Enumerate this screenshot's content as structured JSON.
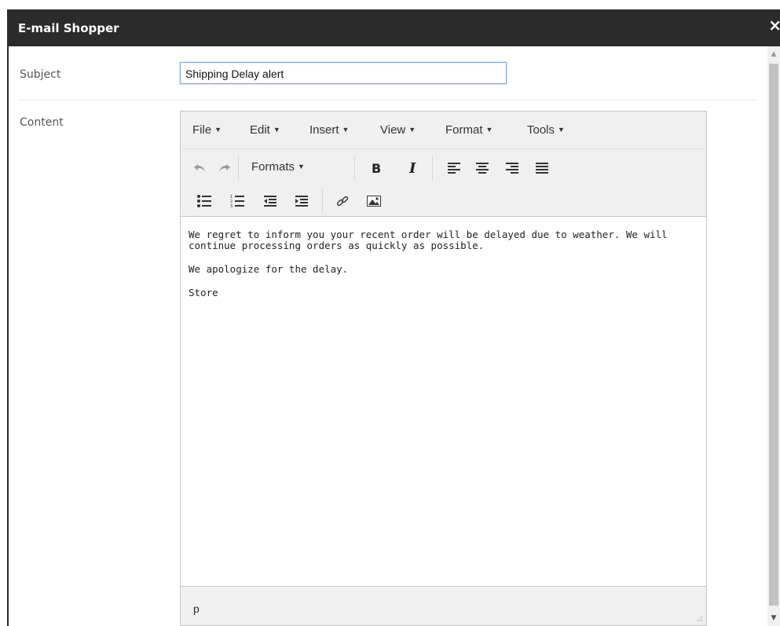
{
  "dialog": {
    "title": "E-mail Shopper",
    "close_glyph": "×"
  },
  "form": {
    "subject_label": "Subject",
    "subject_value": "Shipping Delay alert",
    "content_label": "Content"
  },
  "editor": {
    "menus": [
      {
        "label": "File"
      },
      {
        "label": "Edit"
      },
      {
        "label": "Insert"
      },
      {
        "label": "View"
      },
      {
        "label": "Format"
      },
      {
        "label": "Tools"
      }
    ],
    "toolbar": {
      "formats_label": "Formats",
      "icons": [
        "undo-icon",
        "redo-icon",
        "bold-icon",
        "italic-icon",
        "align-left-icon",
        "align-center-icon",
        "align-right-icon",
        "align-justify-icon",
        "bullet-list-icon",
        "numbered-list-icon",
        "outdent-icon",
        "indent-icon",
        "link-icon",
        "image-icon"
      ]
    },
    "paragraphs": [
      "We regret to inform you your recent order will be delayed due to weather.  We will continue processing orders as quickly as possible.",
      "We apologize for the delay.",
      "Store"
    ],
    "status_path": "p"
  },
  "colors": {
    "titlebar_bg": "#2b2b2b",
    "focus_border": "#7ea6dc",
    "toolbar_bg": "#f0f0f0"
  }
}
